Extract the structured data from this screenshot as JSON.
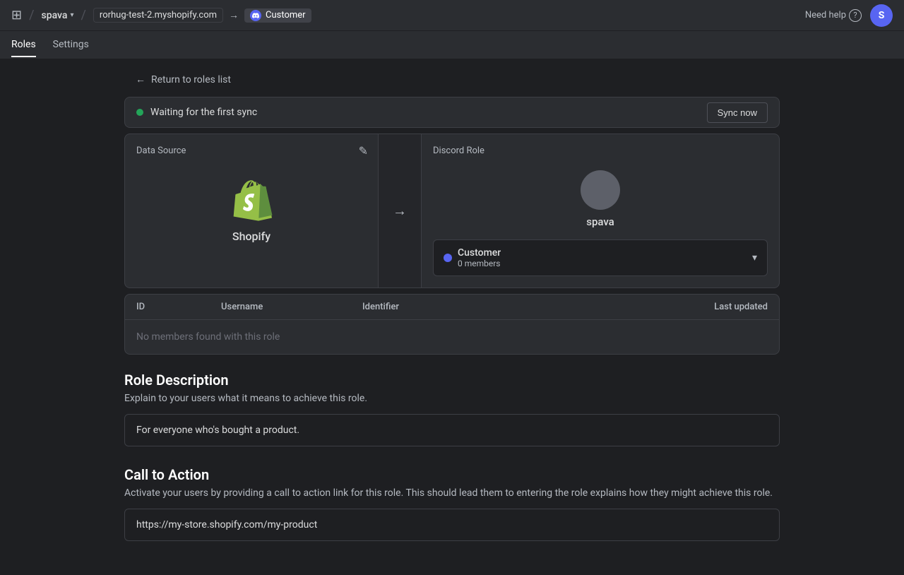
{
  "topbar": {
    "grid_icon": "⊞",
    "workspace": "spava",
    "chevron": "▾",
    "separator": "/",
    "shopify_breadcrumb": "rorhug-test-2.myshopify.com",
    "arrow": "→",
    "customer_label": "Customer",
    "discord_icon": "d",
    "need_help": "Need help",
    "question_mark": "?",
    "avatar_initials": "S"
  },
  "secondnav": {
    "items": [
      {
        "label": "Roles",
        "active": true
      },
      {
        "label": "Settings",
        "active": false
      }
    ]
  },
  "back_link": "Return to roles list",
  "sync_bar": {
    "status_text": "Waiting for the first sync",
    "sync_button": "Sync now"
  },
  "data_source_card": {
    "label": "Data Source",
    "edit_icon": "✎",
    "platform_name": "Shopify"
  },
  "discord_role_card": {
    "label": "Discord Role",
    "server_name": "spava",
    "role_name": "Customer",
    "role_members": "0 members",
    "role_color": "#5865f2"
  },
  "table": {
    "columns": [
      "ID",
      "Username",
      "Identifier",
      "Last updated"
    ],
    "empty_message": "No members found with this role"
  },
  "role_description": {
    "title": "Role Description",
    "description": "Explain to your users what it means to achieve this role.",
    "value": "For everyone who's bought a product."
  },
  "call_to_action": {
    "title": "Call to Action",
    "description": "Activate your users by providing a call to action link for this role. This should lead them to entering the role explains how they might achieve this role.",
    "value": "https://my-store.shopify.com/my-product"
  }
}
